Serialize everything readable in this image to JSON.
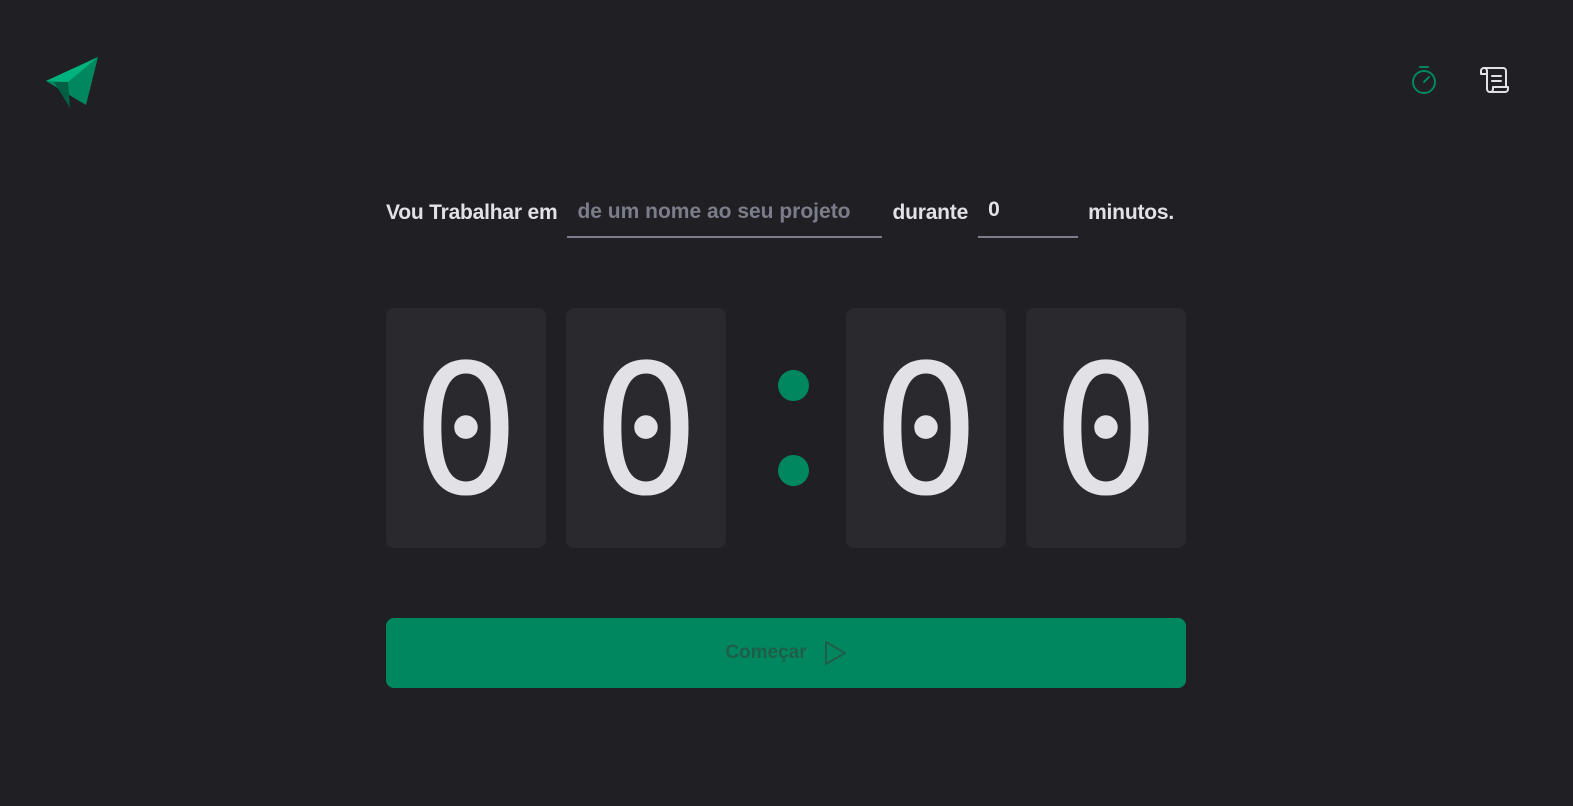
{
  "header": {
    "logo_icon": "paper-plane-logo",
    "nav": [
      {
        "name": "timer",
        "icon": "timer-icon",
        "active": true
      },
      {
        "name": "history",
        "icon": "scroll-icon",
        "active": false
      }
    ]
  },
  "form": {
    "task_label": "Vou Trabalhar em",
    "task_placeholder": "de um nome ao seu projeto",
    "task_value": "",
    "duration_label": "durante",
    "minutes_value": "0",
    "minutes_suffix": "minutos."
  },
  "countdown": {
    "digits": [
      "0",
      "0",
      "0",
      "0"
    ],
    "separator": ":"
  },
  "start_button": {
    "label": "Começar",
    "icon": "play-icon",
    "disabled": true
  },
  "colors": {
    "background": "#202024",
    "card": "#29292e",
    "accent": "#00875f",
    "text": "#e1e1e6",
    "placeholder": "#7c7c8a"
  }
}
